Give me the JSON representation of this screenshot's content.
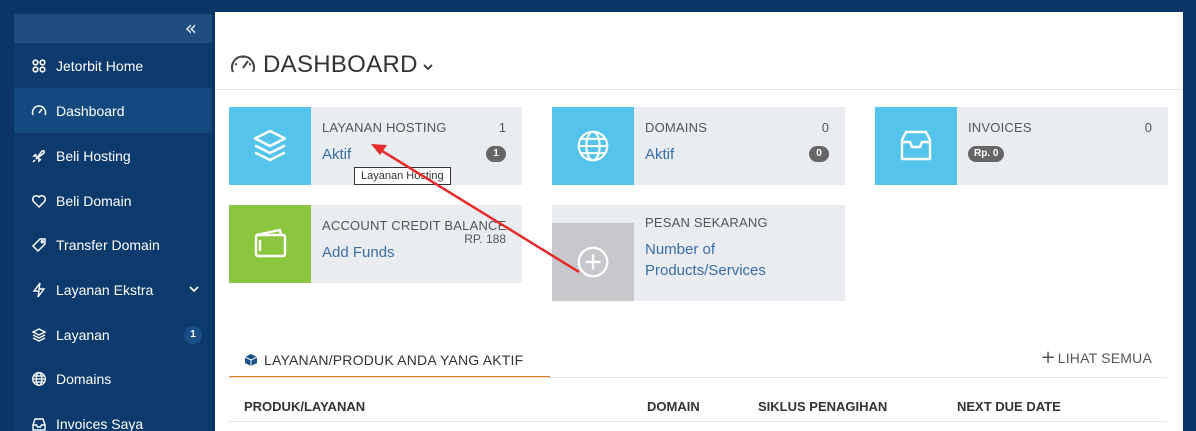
{
  "sidebar": {
    "collapse_icon": "double-chevron-left-icon",
    "items": [
      {
        "label": "Jetorbit Home",
        "icon": "cluster-icon"
      },
      {
        "label": "Dashboard",
        "icon": "speedometer-icon",
        "active": true
      },
      {
        "label": "Beli Hosting",
        "icon": "rocket-icon"
      },
      {
        "label": "Beli Domain",
        "icon": "heart-icon"
      },
      {
        "label": "Transfer Domain",
        "icon": "tag-icon"
      },
      {
        "label": "Layanan Ekstra",
        "icon": "bolt-icon",
        "has_submenu": true
      },
      {
        "label": "Layanan",
        "icon": "layers-icon",
        "badge": "1"
      },
      {
        "label": "Domains",
        "icon": "globe-icon"
      },
      {
        "label": "Invoices Saya",
        "icon": "inbox-icon"
      }
    ]
  },
  "header": {
    "title": "DASHBOARD"
  },
  "tiles": {
    "hosting": {
      "title": "LAYANAN HOSTING",
      "count": "1",
      "link": "Aktif",
      "badge": "1"
    },
    "domains": {
      "title": "DOMAINS",
      "count": "0",
      "link": "Aktif",
      "badge": "0"
    },
    "invoices": {
      "title": "INVOICES",
      "count": "0",
      "badge": "Rp. 0"
    },
    "credit": {
      "title": "ACCOUNT CREDIT BALANCE",
      "balance": "RP. 188",
      "link": "Add Funds"
    },
    "order": {
      "title": "PESAN SEKARANG",
      "link_line1": "Number of",
      "link_line2": "Products/Services"
    }
  },
  "tooltip": "Layanan Hosting",
  "section": {
    "tab_label": "LAYANAN/PRODUK ANDA YANG AKTIF",
    "see_all": "LIHAT SEMUA",
    "columns": [
      "PRODUK/LAYANAN",
      "DOMAIN",
      "SIKLUS PENAGIHAN",
      "NEXT DUE DATE"
    ]
  },
  "colors": {
    "sidebar_bg": "#0c3a6d",
    "tile_cyan": "#55c4ea",
    "tile_green": "#8cc63f",
    "tile_gray": "#c8c8cc",
    "link": "#3a6ea5",
    "tab_underline": "#e67e22",
    "annotation_arrow": "#e52b2b"
  }
}
